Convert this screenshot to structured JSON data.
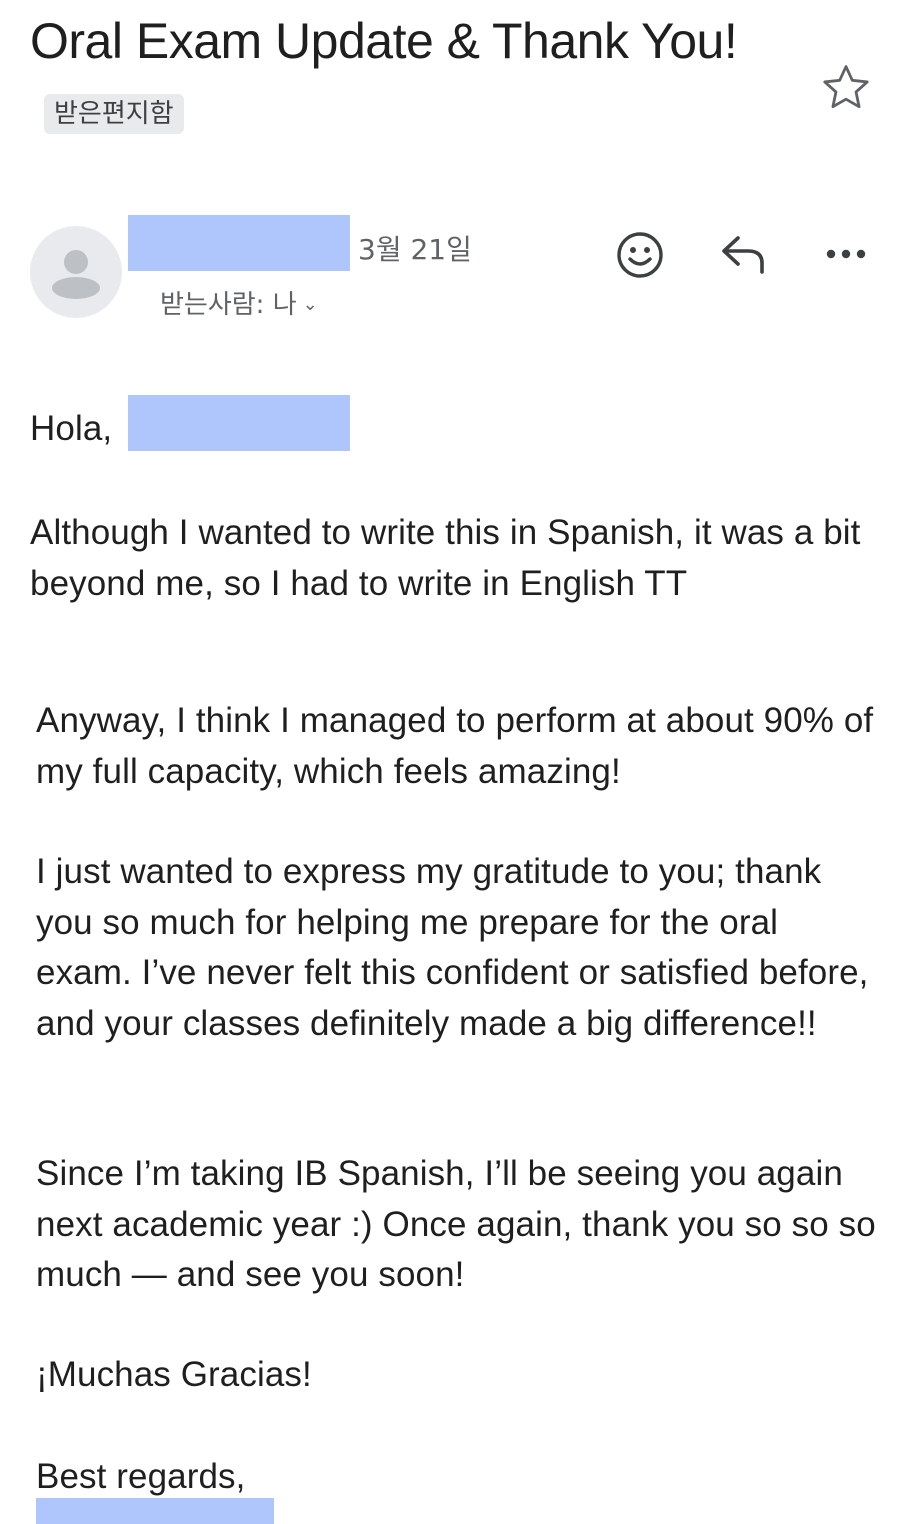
{
  "email": {
    "subject": "Oral Exam Update & Thank You!",
    "label": "받은편지함",
    "date": "3월 21일",
    "recipient": "받는사람: 나",
    "greeting": "Hola,",
    "paragraphs": [
      "Although I wanted to write this in Spanish, it was a bit beyond me, so I had to write in English TT",
      "Anyway, I think I managed to perform at about 90% of my full capacity, which feels amazing!",
      "I just wanted to express my gratitude to you; thank you so much for helping me prepare for the oral exam. I’ve never felt this confident or satisfied before, and your classes definitely made a big difference!!",
      "Since I’m taking IB Spanish, I’ll be seeing you again next academic year :) Once again, thank you so so so much — and see you soon!",
      "¡Muchas Gracias!"
    ],
    "signoff": "Best regards,"
  },
  "icons": [
    "star-icon",
    "avatar-person-icon",
    "emoji-icon",
    "reply-icon",
    "more-options-icon",
    "chevron-down-icon"
  ],
  "colors": {
    "redaction": "#aec6fb",
    "chip_bg": "#e9eaec",
    "meta_text": "#5f6368",
    "body_text": "#1f1f1f"
  }
}
